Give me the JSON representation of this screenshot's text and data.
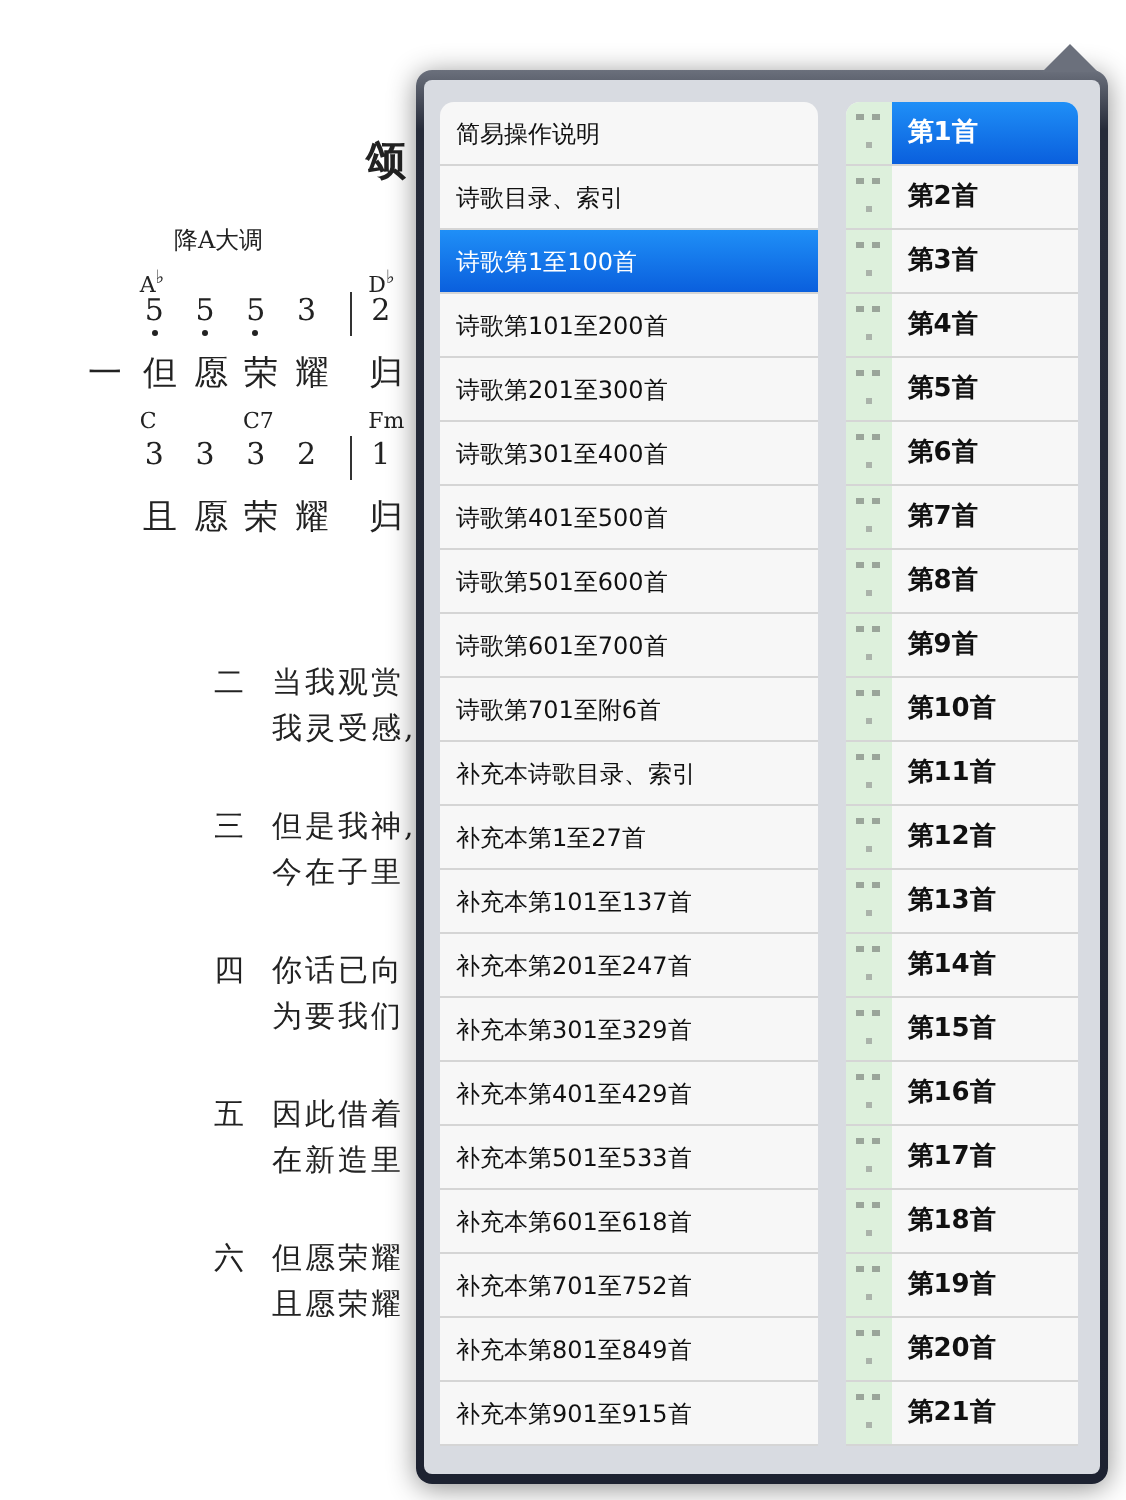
{
  "sheet": {
    "title": "颂",
    "key": "降A大调",
    "lines": [
      {
        "verse": "一",
        "measures": [
          {
            "notes": [
              {
                "chord": "A$^{♭}$",
                "digit": "5",
                "low": true,
                "lyric": "但"
              },
              {
                "digit": "5",
                "low": true,
                "lyric": "愿"
              },
              {
                "digit": "5",
                "low": true,
                "lyric": "荣"
              },
              {
                "digit": "3",
                "low": false,
                "lyric": "耀"
              }
            ]
          },
          {
            "notes": [
              {
                "chord": "D$^{♭}$",
                "digit": "2",
                "low": false,
                "lyric": "归"
              }
            ]
          }
        ]
      },
      {
        "measures": [
          {
            "notes": [
              {
                "chord": "C",
                "digit": "3",
                "low": false,
                "lyric": "且"
              },
              {
                "digit": "3",
                "low": false,
                "lyric": "愿"
              },
              {
                "chord": "C7",
                "digit": "3",
                "low": false,
                "lyric": "荣"
              },
              {
                "digit": "2",
                "low": false,
                "lyric": "耀"
              }
            ]
          },
          {
            "notes": [
              {
                "chord": "Fm",
                "digit": "1",
                "low": false,
                "lyric": "归"
              }
            ]
          }
        ]
      }
    ],
    "verses": [
      {
        "number": "二",
        "lines": [
          "当我观赏",
          "我灵受感,"
        ]
      },
      {
        "number": "三",
        "lines": [
          "但是我神,",
          "今在子里"
        ]
      },
      {
        "number": "四",
        "lines": [
          "你话已向",
          "为要我们"
        ]
      },
      {
        "number": "五",
        "lines": [
          "因此借着",
          "在新造里"
        ]
      },
      {
        "number": "六",
        "lines": [
          "但愿荣耀",
          "且愿荣耀"
        ]
      }
    ]
  },
  "popover": {
    "categories": [
      {
        "label": "简易操作说明",
        "selected": false
      },
      {
        "label": "诗歌目录、索引",
        "selected": false
      },
      {
        "label": "诗歌第1至100首",
        "selected": true
      },
      {
        "label": "诗歌第101至200首",
        "selected": false
      },
      {
        "label": "诗歌第201至300首",
        "selected": false
      },
      {
        "label": "诗歌第301至400首",
        "selected": false
      },
      {
        "label": "诗歌第401至500首",
        "selected": false
      },
      {
        "label": "诗歌第501至600首",
        "selected": false
      },
      {
        "label": "诗歌第601至700首",
        "selected": false
      },
      {
        "label": "诗歌第701至附6首",
        "selected": false
      },
      {
        "label": "补充本诗歌目录、索引",
        "selected": false
      },
      {
        "label": "补充本第1至27首",
        "selected": false
      },
      {
        "label": "补充本第101至137首",
        "selected": false
      },
      {
        "label": "补充本第201至247首",
        "selected": false
      },
      {
        "label": "补充本第301至329首",
        "selected": false
      },
      {
        "label": "补充本第401至429首",
        "selected": false
      },
      {
        "label": "补充本第501至533首",
        "selected": false
      },
      {
        "label": "补充本第601至618首",
        "selected": false
      },
      {
        "label": "补充本第701至752首",
        "selected": false
      },
      {
        "label": "补充本第801至849首",
        "selected": false
      },
      {
        "label": "补充本第901至915首",
        "selected": false
      }
    ],
    "hymns": [
      {
        "label": "第1首",
        "selected": true
      },
      {
        "label": "第2首",
        "selected": false
      },
      {
        "label": "第3首",
        "selected": false
      },
      {
        "label": "第4首",
        "selected": false
      },
      {
        "label": "第5首",
        "selected": false
      },
      {
        "label": "第6首",
        "selected": false
      },
      {
        "label": "第7首",
        "selected": false
      },
      {
        "label": "第8首",
        "selected": false
      },
      {
        "label": "第9首",
        "selected": false
      },
      {
        "label": "第10首",
        "selected": false
      },
      {
        "label": "第11首",
        "selected": false
      },
      {
        "label": "第12首",
        "selected": false
      },
      {
        "label": "第13首",
        "selected": false
      },
      {
        "label": "第14首",
        "selected": false
      },
      {
        "label": "第15首",
        "selected": false
      },
      {
        "label": "第16首",
        "selected": false
      },
      {
        "label": "第17首",
        "selected": false
      },
      {
        "label": "第18首",
        "selected": false
      },
      {
        "label": "第19首",
        "selected": false
      },
      {
        "label": "第20首",
        "selected": false
      },
      {
        "label": "第21首",
        "selected": false
      }
    ]
  }
}
